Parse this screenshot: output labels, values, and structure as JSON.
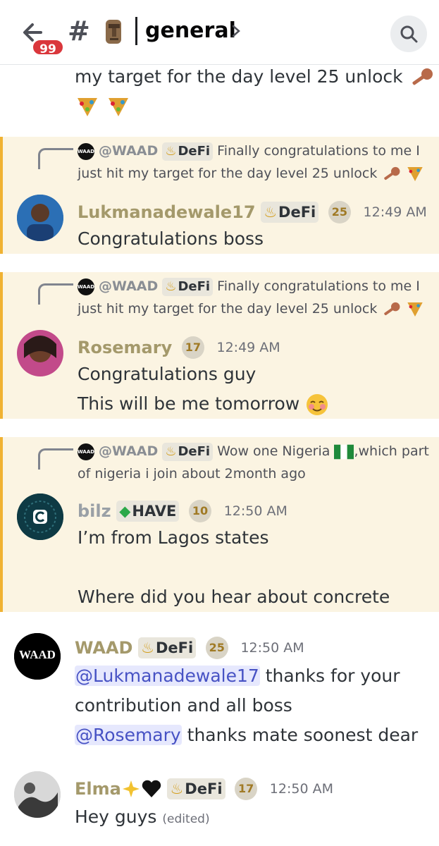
{
  "header": {
    "unread_badge": "99",
    "hash": "#",
    "channel_name": "general",
    "icons": {
      "back": "back-arrow-icon",
      "channel": "moai-emoji-icon",
      "chevron": "chevron-right-icon",
      "search": "search-icon"
    }
  },
  "colors": {
    "highlight_bg": "#fbf4e2",
    "highlight_border": "#f0b232",
    "badge_red": "#da373c",
    "mention_bg": "#e6e8fd",
    "mention_text": "#4752c4"
  },
  "top_continuation": {
    "text": "my target for the day level 25 unlock"
  },
  "messages": [
    {
      "reply": {
        "avatar_text": "WAAD",
        "name": "@WAAD",
        "tag": "DeFi",
        "text": "Finally congratulations to me I just hit my target for the day level 25 unlock"
      },
      "author": "Lukmanadewale17",
      "tag": "DeFi",
      "level": "25",
      "time": "12:49 AM",
      "lines": [
        "Congratulations boss"
      ]
    },
    {
      "reply": {
        "avatar_text": "WAAD",
        "name": "@WAAD",
        "tag": "DeFi",
        "text": "Finally congratulations to me I just hit my target for the day level 25 unlock"
      },
      "author": "Rosemary",
      "level": "17",
      "time": "12:49 AM",
      "lines": [
        "Congratulations guy",
        "This will be me tomorrow"
      ]
    },
    {
      "reply": {
        "avatar_text": "WAAD",
        "name": "@WAAD",
        "tag": "DeFi",
        "text_a": "Wow one Nigeria",
        "text_b": ",which part of nigeria i join about 2month ago"
      },
      "author": "bilz",
      "tag": "HAVE",
      "level": "10",
      "time": "12:50 AM",
      "lines": [
        "I’m from Lagos states",
        "",
        "Where did you hear about concrete"
      ]
    },
    {
      "author": "WAAD",
      "tag": "DeFi",
      "level": "25",
      "time": "12:50 AM",
      "avatar_text": "WAAD",
      "mention1": "@Lukmanadewale17",
      "text1": " thanks for your contribution and all boss",
      "mention2": "@Rosemary",
      "text2": " thanks mate soonest dear"
    },
    {
      "author": "Elma",
      "tag": "DeFi",
      "level": "17",
      "time": "12:50 AM",
      "text": "Hey guys",
      "edited": "(edited)"
    }
  ]
}
